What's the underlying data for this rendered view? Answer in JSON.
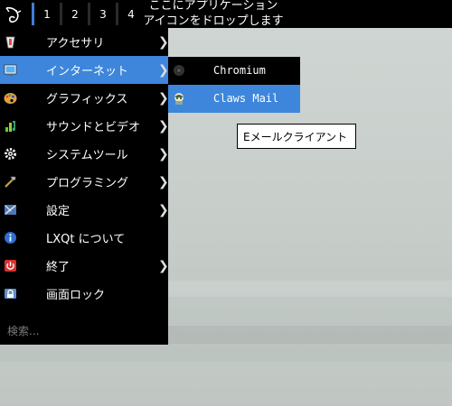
{
  "panel": {
    "workspaces": [
      "1",
      "2",
      "3",
      "4"
    ],
    "active_workspace": "1",
    "drop_message_line1": "ここにアプリケーション",
    "drop_message_line2": "アイコンをドロップします",
    "start_icon": "lxqt-logo-icon"
  },
  "menu": {
    "items": [
      {
        "label": "アクセサリ",
        "icon": "accessories-icon",
        "submenu": true
      },
      {
        "label": "インターネット",
        "icon": "internet-icon",
        "submenu": true
      },
      {
        "label": "グラフィックス",
        "icon": "graphics-icon",
        "submenu": true
      },
      {
        "label": "サウンドとビデオ",
        "icon": "multimedia-icon",
        "submenu": true
      },
      {
        "label": "システムツール",
        "icon": "system-tools-icon",
        "submenu": true
      },
      {
        "label": "プログラミング",
        "icon": "programming-icon",
        "submenu": true
      },
      {
        "label": "設定",
        "icon": "settings-icon",
        "submenu": true
      },
      {
        "label": "LXQt について",
        "icon": "about-icon",
        "submenu": false
      },
      {
        "label": "終了",
        "icon": "leave-icon",
        "submenu": true
      },
      {
        "label": "画面ロック",
        "icon": "lock-icon",
        "submenu": false
      }
    ],
    "arrow": "❯",
    "search_placeholder": "検索..."
  },
  "submenu": {
    "items": [
      {
        "label": "Chromium",
        "icon": "chromium-icon"
      },
      {
        "label": "Claws Mail",
        "icon": "claws-mail-icon"
      }
    ]
  },
  "tooltip": {
    "text": "Eメールクライアント"
  },
  "colors": {
    "panel_bg": "#000000",
    "highlight": "#3d86dc",
    "workspace_accent": "#3f7fd6",
    "desktop": "#c9d0cd"
  }
}
